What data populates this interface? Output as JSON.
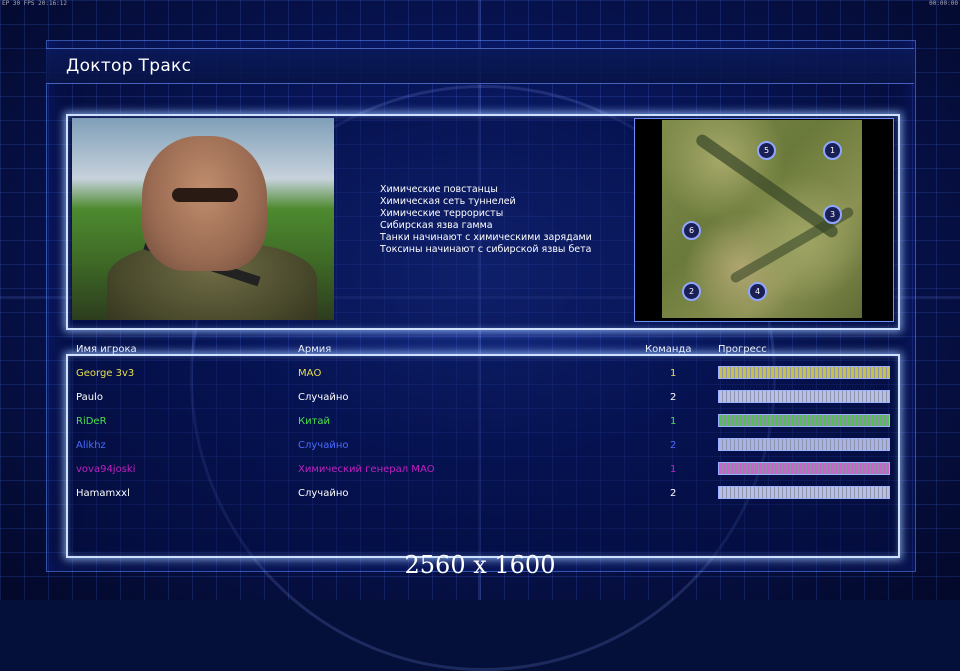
{
  "topbar": {
    "left": "EP  30 FPS  20:16:12",
    "right": "00:00:00"
  },
  "title": "Доктор Тракс",
  "briefing": [
    "Химические повстанцы",
    "Химическая сеть туннелей",
    "Химические террористы",
    "Сибирская язва гамма",
    "Танки начинают с химическими зарядами",
    "Токсины начинают с сибирской язвы бета"
  ],
  "map": {
    "markers": [
      "5",
      "1",
      "3",
      "6",
      "2",
      "4"
    ]
  },
  "table": {
    "headers": {
      "name": "Имя игрока",
      "army": "Армия",
      "team": "Команда",
      "progress": "Прогресс"
    },
    "rows": [
      {
        "name": "George 3v3",
        "army": "МАО",
        "team": "1",
        "color": "#e6e04a",
        "bar": "#c9c24a",
        "progress": 1.0
      },
      {
        "name": "Paulo",
        "army": "Случайно",
        "team": "2",
        "color": "#ffffff",
        "bar": "#b8c0e8",
        "progress": 1.0
      },
      {
        "name": "RiDeR",
        "army": "Китай",
        "team": "1",
        "color": "#4be04b",
        "bar": "#4fc24f",
        "progress": 1.0
      },
      {
        "name": "Alikhz",
        "army": "Случайно",
        "team": "2",
        "color": "#4a6bff",
        "bar": "#a8b4e6",
        "progress": 1.0
      },
      {
        "name": "vova94joski",
        "army": "Химический генерал МАО",
        "team": "1",
        "color": "#c020c0",
        "bar": "#d060d0",
        "progress": 1.0
      },
      {
        "name": "Hamamxxl",
        "army": "Случайно",
        "team": "2",
        "color": "#ffffff",
        "bar": "#b8c0e8",
        "progress": 1.0
      }
    ]
  },
  "resolution": "2560 x 1600"
}
